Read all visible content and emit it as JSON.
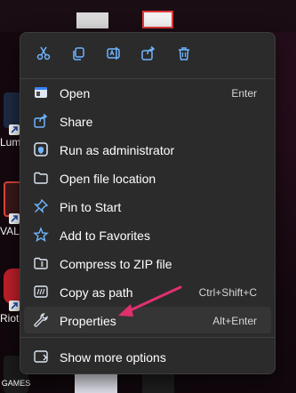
{
  "desktop": {
    "shortcuts": [
      {
        "label": "Lum"
      },
      {
        "label": "VAL"
      },
      {
        "label": "Riot"
      },
      {
        "label": "GAMES"
      }
    ]
  },
  "context_menu": {
    "toolbar": [
      {
        "icon": "scissors-icon",
        "tooltip": "Cut"
      },
      {
        "icon": "copy-icon",
        "tooltip": "Copy"
      },
      {
        "icon": "rename-icon",
        "tooltip": "Rename"
      },
      {
        "icon": "share-icon",
        "tooltip": "Share"
      },
      {
        "icon": "trash-icon",
        "tooltip": "Delete"
      }
    ],
    "items": [
      {
        "label": "Open",
        "shortcut": "Enter",
        "icon": "open-app-icon"
      },
      {
        "label": "Share",
        "shortcut": "",
        "icon": "share-icon"
      },
      {
        "label": "Run as administrator",
        "shortcut": "",
        "icon": "shield-icon"
      },
      {
        "label": "Open file location",
        "shortcut": "",
        "icon": "folder-icon"
      },
      {
        "label": "Pin to Start",
        "shortcut": "",
        "icon": "pin-icon"
      },
      {
        "label": "Add to Favorites",
        "shortcut": "",
        "icon": "star-icon"
      },
      {
        "label": "Compress to ZIP file",
        "shortcut": "",
        "icon": "zip-folder-icon"
      },
      {
        "label": "Copy as path",
        "shortcut": "Ctrl+Shift+C",
        "icon": "copy-path-icon"
      },
      {
        "label": "Properties",
        "shortcut": "Alt+Enter",
        "icon": "wrench-icon"
      },
      {
        "label": "Show more options",
        "shortcut": "",
        "icon": "more-options-icon"
      }
    ]
  },
  "colors": {
    "menu_bg": "#2b2b2b",
    "accent_blue": "#6fb5ff",
    "annotation_pink": "#e0306f"
  }
}
